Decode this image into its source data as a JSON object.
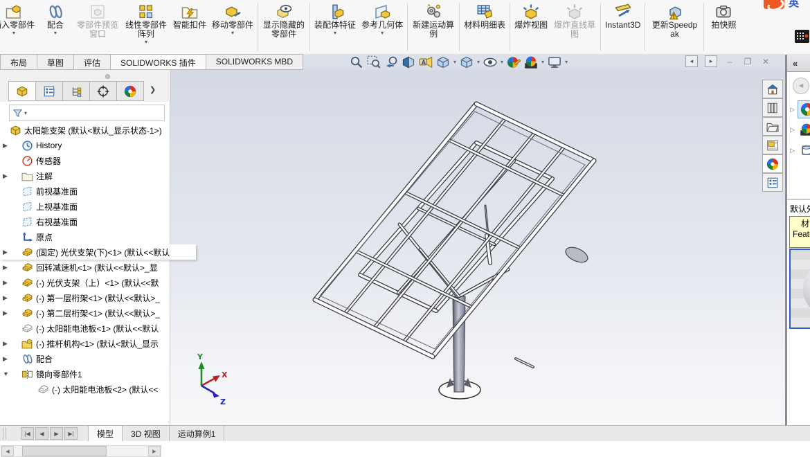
{
  "ribbon": {
    "buttons": [
      {
        "label": "插入零部件",
        "icon": "insert-component",
        "dropdown": true,
        "disabled": false
      },
      {
        "label": "配合",
        "icon": "mate",
        "dropdown": true,
        "disabled": false
      },
      {
        "label": "零部件预览窗口",
        "icon": "component-preview-window",
        "dropdown": false,
        "disabled": true
      },
      {
        "label": "线性零部件阵列",
        "icon": "linear-component-pattern",
        "dropdown": true,
        "disabled": false
      },
      {
        "label": "智能扣件",
        "icon": "smart-fasteners",
        "dropdown": false,
        "disabled": false
      },
      {
        "label": "移动零部件",
        "icon": "move-component",
        "dropdown": true,
        "disabled": false
      },
      {
        "label": "显示隐藏的零部件",
        "icon": "show-hidden-components",
        "dropdown": false,
        "disabled": false
      },
      {
        "label": "装配体特征",
        "icon": "assembly-features",
        "dropdown": true,
        "disabled": false
      },
      {
        "label": "参考几何体",
        "icon": "reference-geometry",
        "dropdown": true,
        "disabled": false
      },
      {
        "label": "新建运动算例",
        "icon": "new-motion-study",
        "dropdown": false,
        "disabled": false
      },
      {
        "label": "材料明细表",
        "icon": "bill-of-materials",
        "dropdown": false,
        "disabled": false
      },
      {
        "label": "爆炸视图",
        "icon": "exploded-view",
        "dropdown": false,
        "disabled": false
      },
      {
        "label": "爆炸直线草图",
        "icon": "explode-line-sketch",
        "dropdown": false,
        "disabled": true
      },
      {
        "label": "Instant3D",
        "icon": "instant3d",
        "dropdown": false,
        "disabled": false
      },
      {
        "label": "更新Speedpak",
        "icon": "update-speedpak",
        "dropdown": false,
        "disabled": false
      },
      {
        "label": "拍快照",
        "icon": "take-snapshot",
        "dropdown": false,
        "disabled": false
      }
    ]
  },
  "command_tabs": {
    "items": [
      "布局",
      "草图",
      "评估",
      "SOLIDWORKS 插件",
      "SOLIDWORKS MBD"
    ],
    "active": "SOLIDWORKS 插件"
  },
  "headsup_icons": [
    "zoom-to-fit",
    "zoom-to-area",
    "previous-view",
    "section-view",
    "hide-show-annotations",
    "view-orientation",
    "display-style",
    "hide-show-items",
    "edit-appearance",
    "apply-scene",
    "view-settings"
  ],
  "feature_tree": {
    "items": [
      {
        "label": "太阳能支架 (默认<默认_显示状态-1>)",
        "icon": "assembly"
      },
      {
        "label": "History",
        "icon": "history-folder"
      },
      {
        "label": "传感器",
        "icon": "sensors-folder"
      },
      {
        "label": "注解",
        "icon": "annotations-folder"
      },
      {
        "label": "前视基准面",
        "icon": "plane"
      },
      {
        "label": "上视基准面",
        "icon": "plane"
      },
      {
        "label": "右视基准面",
        "icon": "plane"
      },
      {
        "label": "原点",
        "icon": "origin"
      },
      {
        "label": "(固定) 光伏支架(下)<1> (默认<<默认",
        "icon": "part"
      },
      {
        "label": "回转减速机<1> (默认<<默认>_显",
        "icon": "part"
      },
      {
        "label": "(-) 光伏支架（上）<1> (默认<<默",
        "icon": "part"
      },
      {
        "label": "(-) 第一层桁架<1> (默认<<默认>_",
        "icon": "part"
      },
      {
        "label": "(-) 第二层桁架<1> (默认<<默认>_",
        "icon": "part"
      },
      {
        "label": "(-) 太阳能电池板<1> (默认<<默认",
        "icon": "part-hidden"
      },
      {
        "label": "(-) 推杆机构<1> (默认<默认_显示",
        "icon": "subassembly"
      },
      {
        "label": "配合",
        "icon": "mates-folder"
      },
      {
        "label": "镜向零部件1",
        "icon": "mirror-feature"
      },
      {
        "label": "(-) 太阳能电池板<2> (默认<<",
        "icon": "part-hidden"
      }
    ]
  },
  "bottom_bar": {
    "tabs": [
      "模型",
      "3D 视图",
      "运动算例1"
    ],
    "active": "模型"
  },
  "task_pane": {
    "collapse_glyph": "«",
    "tabs": [
      "solidworks-resources",
      "design-library",
      "file-explorer",
      "view-palette",
      "appearances-scenes",
      "custom-properties"
    ],
    "tree_items": [
      "appearances",
      "scenes",
      "decals"
    ],
    "section_header": "默认外",
    "hint_line1": "材",
    "hint_line2": "Featur"
  },
  "ime": {
    "lang_indicator": "英"
  },
  "triad": {
    "x": "X",
    "y": "Y",
    "z": "Z"
  },
  "colors": {
    "rollback_blue": "#2458b8",
    "hint_yellow": "#ffffc8",
    "preview_border": "#2f5bc4",
    "part_yellow": "#f2c63d"
  }
}
